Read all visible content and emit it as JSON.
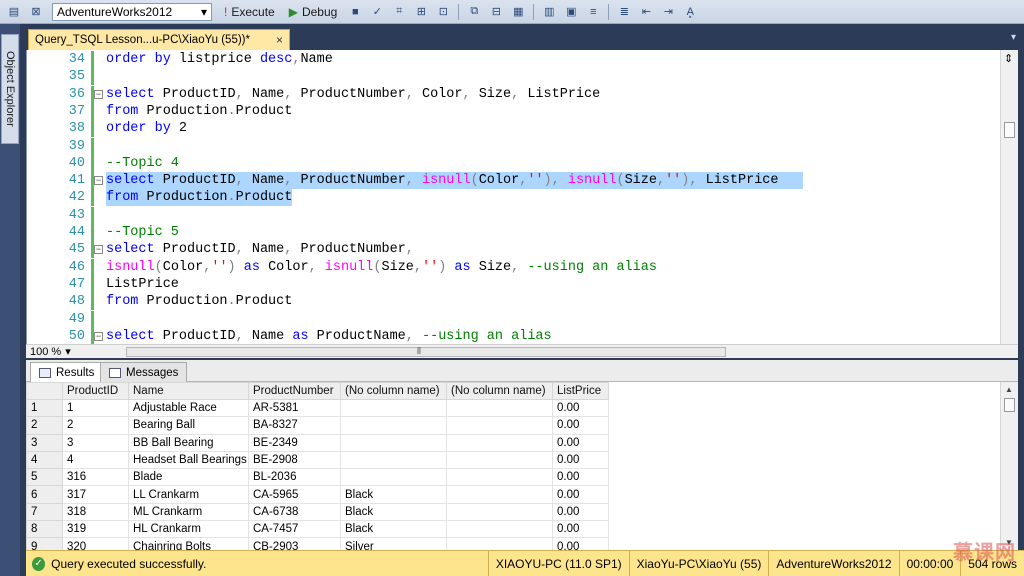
{
  "toolbar": {
    "database": "AdventureWorks2012",
    "execute_label": "Execute",
    "debug_label": "Debug"
  },
  "side_panel": {
    "label": "Object Explorer"
  },
  "doc_tab": {
    "title": "Query_TSQL Lesson...u-PC\\XiaoYu (55))*",
    "close": "×"
  },
  "editor": {
    "lines": [
      {
        "n": "34",
        "tokens": [
          [
            "kw",
            "order by "
          ],
          [
            "tx",
            "listprice "
          ],
          [
            "kw",
            "desc"
          ],
          [
            "gr",
            ","
          ],
          [
            "tx",
            "Name"
          ]
        ]
      },
      {
        "n": "35",
        "tokens": []
      },
      {
        "n": "36",
        "fold": "−",
        "tokens": [
          [
            "kw",
            "select "
          ],
          [
            "tx",
            "ProductID"
          ],
          [
            "gr",
            ", "
          ],
          [
            "tx",
            "Name"
          ],
          [
            "gr",
            ", "
          ],
          [
            "tx",
            "ProductNumber"
          ],
          [
            "gr",
            ", "
          ],
          [
            "tx",
            "Color"
          ],
          [
            "gr",
            ", "
          ],
          [
            "tx",
            "Size"
          ],
          [
            "gr",
            ", "
          ],
          [
            "tx",
            "ListPrice"
          ]
        ]
      },
      {
        "n": "37",
        "tokens": [
          [
            "kw",
            "from "
          ],
          [
            "tx",
            "Production"
          ],
          [
            "gr",
            "."
          ],
          [
            "tx",
            "Product"
          ]
        ]
      },
      {
        "n": "38",
        "tokens": [
          [
            "kw",
            "order by "
          ],
          [
            "tx",
            "2"
          ]
        ]
      },
      {
        "n": "39",
        "tokens": []
      },
      {
        "n": "40",
        "tokens": [
          [
            "cm",
            "--Topic 4"
          ]
        ]
      },
      {
        "n": "41",
        "fold": "−",
        "selected": true,
        "tokens": [
          [
            "kw",
            "select "
          ],
          [
            "tx",
            "ProductID"
          ],
          [
            "gr",
            ", "
          ],
          [
            "tx",
            "Name"
          ],
          [
            "gr",
            ", "
          ],
          [
            "tx",
            "ProductNumber"
          ],
          [
            "gr",
            ", "
          ],
          [
            "fn",
            "isnull"
          ],
          [
            "gr",
            "("
          ],
          [
            "tx",
            "Color"
          ],
          [
            "gr",
            ","
          ],
          [
            "str",
            "''"
          ],
          [
            "gr",
            "), "
          ],
          [
            "fn",
            "isnull"
          ],
          [
            "gr",
            "("
          ],
          [
            "tx",
            "Size"
          ],
          [
            "gr",
            ","
          ],
          [
            "str",
            "''"
          ],
          [
            "gr",
            "), "
          ],
          [
            "tx",
            "ListPrice"
          ],
          [
            "tx",
            "   "
          ]
        ]
      },
      {
        "n": "42",
        "selected": true,
        "tokens": [
          [
            "kw",
            "from "
          ],
          [
            "tx",
            "Production"
          ],
          [
            "gr",
            "."
          ],
          [
            "tx",
            "Product"
          ]
        ]
      },
      {
        "n": "43",
        "tokens": []
      },
      {
        "n": "44",
        "tokens": [
          [
            "cm",
            "--Topic 5"
          ]
        ]
      },
      {
        "n": "45",
        "fold": "−",
        "tokens": [
          [
            "kw",
            "select "
          ],
          [
            "tx",
            "ProductID"
          ],
          [
            "gr",
            ", "
          ],
          [
            "tx",
            "Name"
          ],
          [
            "gr",
            ", "
          ],
          [
            "tx",
            "ProductNumber"
          ],
          [
            "gr",
            ","
          ]
        ]
      },
      {
        "n": "46",
        "tokens": [
          [
            "fn",
            "isnull"
          ],
          [
            "gr",
            "("
          ],
          [
            "tx",
            "Color"
          ],
          [
            "gr",
            ","
          ],
          [
            "str",
            "''"
          ],
          [
            "gr",
            ") "
          ],
          [
            "kw",
            "as "
          ],
          [
            "tx",
            "Color"
          ],
          [
            "gr",
            ", "
          ],
          [
            "fn",
            "isnull"
          ],
          [
            "gr",
            "("
          ],
          [
            "tx",
            "Size"
          ],
          [
            "gr",
            ","
          ],
          [
            "str",
            "''"
          ],
          [
            "gr",
            ") "
          ],
          [
            "kw",
            "as "
          ],
          [
            "tx",
            "Size"
          ],
          [
            "gr",
            ", "
          ],
          [
            "cm",
            "--using an alias"
          ]
        ]
      },
      {
        "n": "47",
        "tokens": [
          [
            "tx",
            "ListPrice"
          ]
        ]
      },
      {
        "n": "48",
        "tokens": [
          [
            "kw",
            "from "
          ],
          [
            "tx",
            "Production"
          ],
          [
            "gr",
            "."
          ],
          [
            "tx",
            "Product"
          ]
        ]
      },
      {
        "n": "49",
        "tokens": []
      },
      {
        "n": "50",
        "fold": "−",
        "tokens": [
          [
            "kw",
            "select "
          ],
          [
            "tx",
            "ProductID"
          ],
          [
            "gr",
            ", "
          ],
          [
            "tx",
            "Name "
          ],
          [
            "kw",
            "as "
          ],
          [
            "tx",
            "ProductName"
          ],
          [
            "gr",
            ", "
          ],
          [
            "cm",
            "--using an alias"
          ]
        ]
      }
    ]
  },
  "editor_status": {
    "zoom": "100 %"
  },
  "results_tabs": {
    "results": "Results",
    "messages": "Messages"
  },
  "grid": {
    "columns": [
      "",
      "ProductID",
      "Name",
      "ProductNumber",
      "(No column name)",
      "(No column name)",
      "ListPrice"
    ],
    "rows": [
      [
        "1",
        "1",
        "Adjustable Race",
        "AR-5381",
        "",
        "",
        "0.00"
      ],
      [
        "2",
        "2",
        "Bearing Ball",
        "BA-8327",
        "",
        "",
        "0.00"
      ],
      [
        "3",
        "3",
        "BB Ball Bearing",
        "BE-2349",
        "",
        "",
        "0.00"
      ],
      [
        "4",
        "4",
        "Headset Ball Bearings",
        "BE-2908",
        "",
        "",
        "0.00"
      ],
      [
        "5",
        "316",
        "Blade",
        "BL-2036",
        "",
        "",
        "0.00"
      ],
      [
        "6",
        "317",
        "LL Crankarm",
        "CA-5965",
        "Black",
        "",
        "0.00"
      ],
      [
        "7",
        "318",
        "ML Crankarm",
        "CA-6738",
        "Black",
        "",
        "0.00"
      ],
      [
        "8",
        "319",
        "HL Crankarm",
        "CA-7457",
        "Black",
        "",
        "0.00"
      ],
      [
        "9",
        "320",
        "Chainring Bolts",
        "CB-2903",
        "Silver",
        "",
        "0.00"
      ]
    ]
  },
  "statusbar": {
    "message": "Query executed successfully.",
    "server": "XIAOYU-PC (11.0 SP1)",
    "user": "XiaoYu-PC\\XiaoYu (55)",
    "database": "AdventureWorks2012",
    "time": "00:00:00",
    "rows": "504 rows"
  },
  "watermark": "慕课网"
}
